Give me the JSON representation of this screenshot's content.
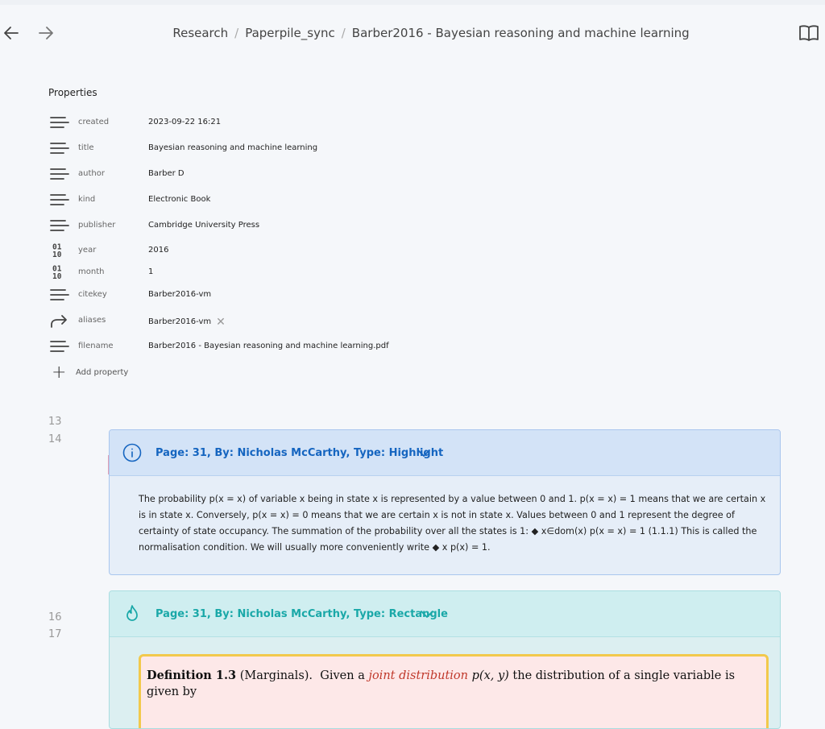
{
  "breadcrumb": {
    "items": [
      "Research",
      "Paperpile_sync",
      "Barber2016 - Bayesian reasoning and machine learning"
    ],
    "separator": "/"
  },
  "properties": {
    "heading": "Properties",
    "rows": [
      {
        "icon": "text-lines-icon",
        "key": "created",
        "value": "2023-09-22 16:21"
      },
      {
        "icon": "text-lines-icon",
        "key": "title",
        "value": "Bayesian reasoning and machine learning"
      },
      {
        "icon": "text-lines-icon",
        "key": "author",
        "value": "Barber D"
      },
      {
        "icon": "text-lines-icon",
        "key": "kind",
        "value": "Electronic Book"
      },
      {
        "icon": "text-lines-icon",
        "key": "publisher",
        "value": "Cambridge University Press"
      },
      {
        "icon": "binary-number-icon",
        "key": "year",
        "value": "2016"
      },
      {
        "icon": "binary-number-icon",
        "key": "month",
        "value": "1"
      },
      {
        "icon": "text-lines-icon",
        "key": "citekey",
        "value": "Barber2016-vm"
      },
      {
        "icon": "forward-arrow-icon",
        "key": "aliases",
        "value": "Barber2016-vm"
      },
      {
        "icon": "text-lines-icon",
        "key": "filename",
        "value": "Barber2016 - Bayesian reasoning and machine learning.pdf"
      }
    ],
    "add_label": "Add property",
    "binary_glyph_top": "01",
    "binary_glyph_bottom": "10"
  },
  "line_numbers": [
    "13",
    "14",
    "16",
    "17"
  ],
  "callouts": [
    {
      "type": "info",
      "title": "Page: 31, By: Nicholas McCarthy, Type: Highlight",
      "color": "#1565c0",
      "body": "The probability p(x = x) of variable x being in state x is represented by a value between 0 and 1. p(x = x) = 1 means that we are certain x is in state x. Conversely, p(x = x) = 0 means that we are certain x is not in state x. Values between 0 and 1 represent the degree of certainty of state occupancy. The summation of the probability over all the states is 1: ◆ x∈dom(x) p(x = x) = 1 (1.1.1) This is called the normalisation condition. We will usually more conveniently write ◆ x p(x) = 1."
    },
    {
      "type": "rectangle",
      "title": "Page: 31, By: Nicholas McCarthy, Type: Rectangle",
      "color": "#1aa8a8",
      "definition": {
        "label": "Definition 1.3",
        "name": "(Marginals).",
        "pre": "Given a",
        "highlight": "joint distribution",
        "math": "p(x, y)",
        "post": "the distribution of a single variable is given by"
      }
    }
  ]
}
